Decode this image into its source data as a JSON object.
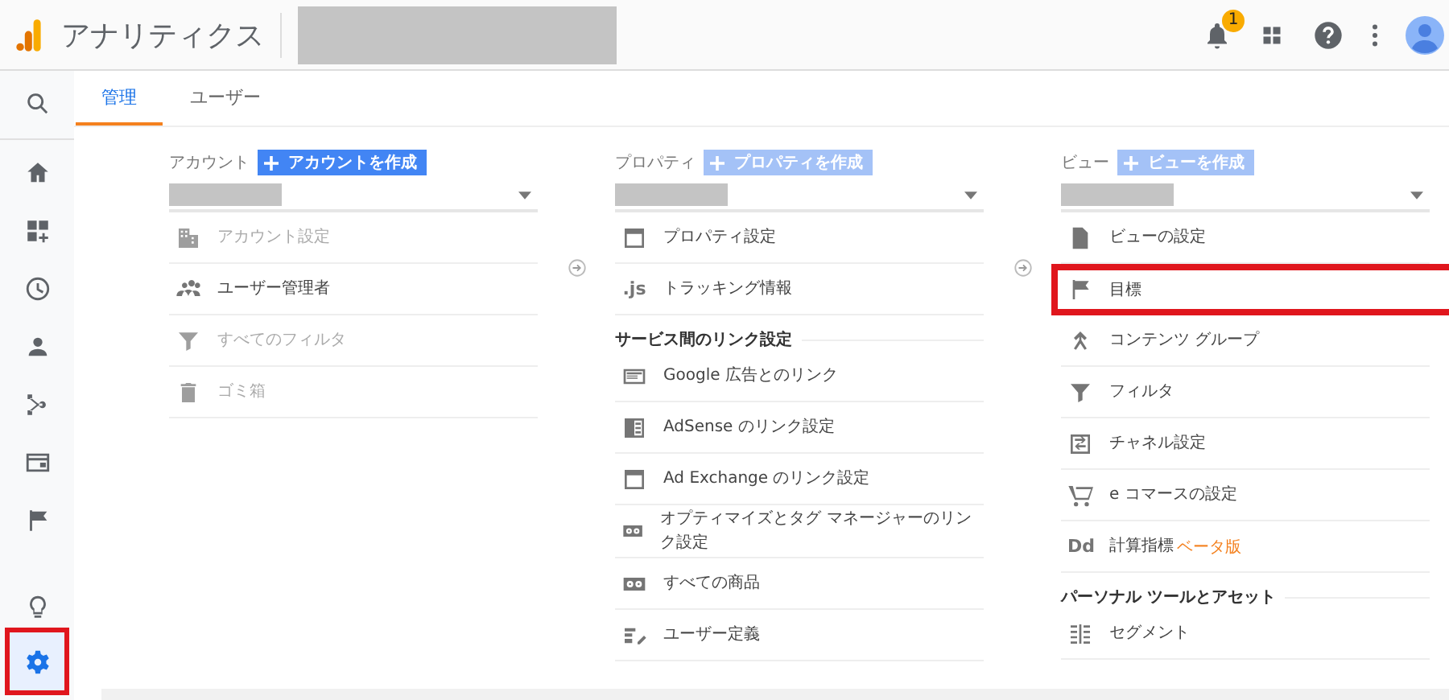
{
  "header": {
    "title": "アナリティクス",
    "notification_count": "1"
  },
  "sidebar": {
    "items": [
      {
        "selected": false,
        "highlighted": false
      },
      {
        "selected": false,
        "highlighted": false
      },
      {
        "selected": false,
        "highlighted": false
      },
      {
        "selected": false,
        "highlighted": false
      },
      {
        "selected": false,
        "highlighted": false
      },
      {
        "selected": false,
        "highlighted": false
      },
      {
        "selected": false,
        "highlighted": false
      },
      {
        "selected": false,
        "highlighted": false
      },
      {
        "selected": false,
        "highlighted": false
      },
      {
        "selected": true,
        "highlighted": true
      }
    ]
  },
  "tabs": [
    {
      "label": "管理",
      "selected": true
    },
    {
      "label": "ユーザー",
      "selected": false
    }
  ],
  "columns": [
    {
      "label": "アカウント",
      "create_button": {
        "label": "アカウントを作成",
        "disabled": false
      },
      "items": [
        {
          "kind": "item",
          "label": "アカウント設定",
          "disabled": true,
          "highlighted": false
        },
        {
          "kind": "item",
          "label": "ユーザー管理者",
          "disabled": false,
          "highlighted": false
        },
        {
          "kind": "item",
          "label": "すべてのフィルタ",
          "disabled": true,
          "highlighted": false
        },
        {
          "kind": "item",
          "label": "ゴミ箱",
          "disabled": true,
          "highlighted": false
        }
      ]
    },
    {
      "label": "プロパティ",
      "create_button": {
        "label": "プロパティを作成",
        "disabled": true
      },
      "items": [
        {
          "kind": "item",
          "label": "プロパティ設定",
          "disabled": false,
          "highlighted": false
        },
        {
          "kind": "item",
          "label": "トラッキング情報",
          "icon_text": ".js",
          "disabled": false,
          "highlighted": false
        },
        {
          "kind": "section",
          "label": "サービス間のリンク設定"
        },
        {
          "kind": "item",
          "label": "Google 広告とのリンク",
          "disabled": false,
          "highlighted": false
        },
        {
          "kind": "item",
          "label": "AdSense のリンク設定",
          "disabled": false,
          "highlighted": false
        },
        {
          "kind": "item",
          "label": "Ad Exchange のリンク設定",
          "disabled": false,
          "highlighted": false
        },
        {
          "kind": "item",
          "label": "オプティマイズとタグ マネージャーのリンク設定",
          "disabled": false,
          "highlighted": false
        },
        {
          "kind": "item",
          "label": "すべての商品",
          "disabled": false,
          "highlighted": false
        },
        {
          "kind": "item",
          "label": "ユーザー定義",
          "disabled": false,
          "highlighted": false
        }
      ]
    },
    {
      "label": "ビュー",
      "create_button": {
        "label": "ビューを作成",
        "disabled": true
      },
      "items": [
        {
          "kind": "item",
          "label": "ビューの設定",
          "disabled": false,
          "highlighted": false
        },
        {
          "kind": "item",
          "label": "目標",
          "disabled": false,
          "highlighted": true
        },
        {
          "kind": "item",
          "label": "コンテンツ グループ",
          "disabled": false,
          "highlighted": false
        },
        {
          "kind": "item",
          "label": "フィルタ",
          "disabled": false,
          "highlighted": false
        },
        {
          "kind": "item",
          "label": "チャネル設定",
          "disabled": false,
          "highlighted": false
        },
        {
          "kind": "item",
          "label": "e コマースの設定",
          "disabled": false,
          "highlighted": false
        },
        {
          "kind": "item",
          "label": "計算指標",
          "icon_text": "Dd",
          "tag": "ベータ版",
          "disabled": false,
          "highlighted": false
        },
        {
          "kind": "section",
          "label": "パーソナル ツールとアセット"
        },
        {
          "kind": "item",
          "label": "セグメント",
          "disabled": false,
          "highlighted": false
        }
      ]
    }
  ]
}
